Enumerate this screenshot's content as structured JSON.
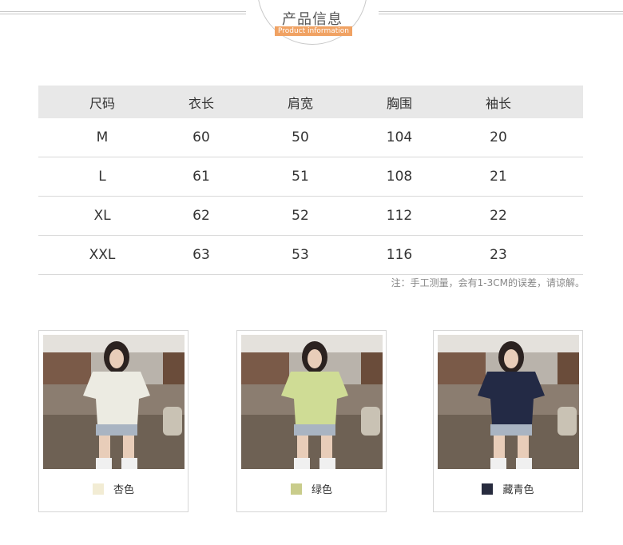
{
  "header": {
    "title": "产品信息",
    "subtitle": "Product information"
  },
  "size_table": {
    "columns": [
      "尺码",
      "衣长",
      "肩宽",
      "胸围",
      "袖长"
    ],
    "rows": [
      [
        "M",
        "60",
        "50",
        "104",
        "20"
      ],
      [
        "L",
        "61",
        "51",
        "108",
        "21"
      ],
      [
        "XL",
        "62",
        "52",
        "112",
        "22"
      ],
      [
        "XXL",
        "63",
        "53",
        "116",
        "23"
      ]
    ]
  },
  "note": "注：手工测量，会有1-3CM的误差，请谅解。",
  "colors": [
    {
      "name": "杏色",
      "swatch": "#f2ecd4",
      "shirt": "#ecebe2"
    },
    {
      "name": "绿色",
      "swatch": "#c9cc8b",
      "shirt": "#cfdc95"
    },
    {
      "name": "藏青色",
      "swatch": "#272b3e",
      "shirt": "#232a45"
    }
  ]
}
